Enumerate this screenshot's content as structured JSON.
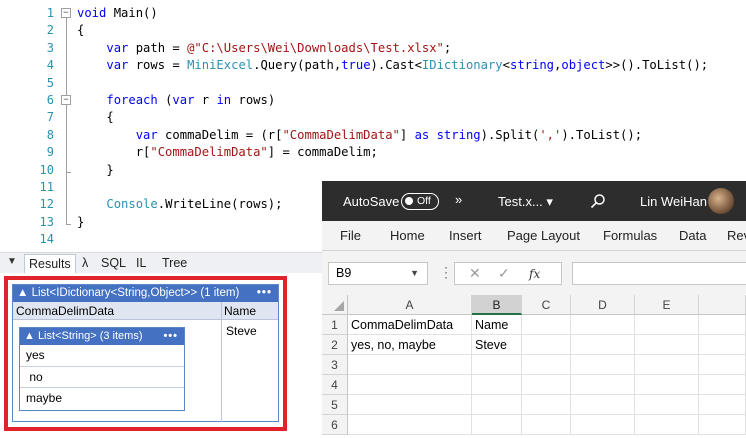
{
  "editor": {
    "lines": [
      {
        "n": "1",
        "parts": [
          {
            "t": "void",
            "c": "kw"
          },
          {
            "t": " Main()",
            "c": ""
          }
        ]
      },
      {
        "n": "2",
        "parts": [
          {
            "t": "{",
            "c": ""
          }
        ]
      },
      {
        "n": "3",
        "parts": [
          {
            "t": "    ",
            "c": ""
          },
          {
            "t": "var",
            "c": "kw"
          },
          {
            "t": " path = ",
            "c": ""
          },
          {
            "t": "@\"C:\\Users\\Wei\\Downloads\\Test.xlsx\"",
            "c": "str"
          },
          {
            "t": ";",
            "c": ""
          }
        ]
      },
      {
        "n": "4",
        "parts": [
          {
            "t": "    ",
            "c": ""
          },
          {
            "t": "var",
            "c": "kw"
          },
          {
            "t": " rows = ",
            "c": ""
          },
          {
            "t": "MiniExcel",
            "c": "ty"
          },
          {
            "t": ".Query(path,",
            "c": ""
          },
          {
            "t": "true",
            "c": "kw"
          },
          {
            "t": ").Cast<",
            "c": ""
          },
          {
            "t": "IDictionary",
            "c": "ty"
          },
          {
            "t": "<",
            "c": ""
          },
          {
            "t": "string",
            "c": "kw"
          },
          {
            "t": ",",
            "c": ""
          },
          {
            "t": "object",
            "c": "kw"
          },
          {
            "t": ">>().ToList();",
            "c": ""
          }
        ]
      },
      {
        "n": "5",
        "parts": [
          {
            "t": "",
            "c": ""
          }
        ]
      },
      {
        "n": "6",
        "parts": [
          {
            "t": "    ",
            "c": ""
          },
          {
            "t": "foreach",
            "c": "kw"
          },
          {
            "t": " (",
            "c": ""
          },
          {
            "t": "var",
            "c": "kw"
          },
          {
            "t": " r ",
            "c": ""
          },
          {
            "t": "in",
            "c": "kw"
          },
          {
            "t": " rows)",
            "c": ""
          }
        ]
      },
      {
        "n": "7",
        "parts": [
          {
            "t": "    {",
            "c": ""
          }
        ]
      },
      {
        "n": "8",
        "parts": [
          {
            "t": "        ",
            "c": ""
          },
          {
            "t": "var",
            "c": "kw"
          },
          {
            "t": " commaDelim = (r[",
            "c": ""
          },
          {
            "t": "\"CommaDelimData\"",
            "c": "str"
          },
          {
            "t": "] ",
            "c": ""
          },
          {
            "t": "as",
            "c": "kw"
          },
          {
            "t": " ",
            "c": ""
          },
          {
            "t": "string",
            "c": "kw"
          },
          {
            "t": ").Split(",
            "c": ""
          },
          {
            "t": "','",
            "c": "str"
          },
          {
            "t": ").ToList();",
            "c": ""
          }
        ]
      },
      {
        "n": "9",
        "parts": [
          {
            "t": "        r[",
            "c": ""
          },
          {
            "t": "\"CommaDelimData\"",
            "c": "str"
          },
          {
            "t": "] = commaDelim;",
            "c": ""
          }
        ]
      },
      {
        "n": "10",
        "parts": [
          {
            "t": "    }",
            "c": ""
          }
        ]
      },
      {
        "n": "11",
        "parts": [
          {
            "t": "",
            "c": ""
          }
        ]
      },
      {
        "n": "12",
        "parts": [
          {
            "t": "    ",
            "c": ""
          },
          {
            "t": "Console",
            "c": "ty"
          },
          {
            "t": ".WriteLine(rows);",
            "c": ""
          }
        ]
      },
      {
        "n": "13",
        "parts": [
          {
            "t": "}",
            "c": ""
          }
        ]
      },
      {
        "n": "14",
        "parts": [
          {
            "t": "",
            "c": ""
          }
        ]
      }
    ]
  },
  "results_tabs": {
    "items": [
      "Results",
      "λ",
      "SQL",
      "IL",
      "Tree"
    ],
    "active": "Results"
  },
  "dump": {
    "header": "▲ List<IDictionary<String,Object>> (1 item)",
    "menu": "•••",
    "columns": [
      "CommaDelimData",
      "Name"
    ],
    "name_value": "Steve",
    "inner_header": "▲ List<String> (3 items)",
    "inner_menu": "•••",
    "inner_items": [
      "yes",
      " no",
      "maybe"
    ]
  },
  "excel": {
    "autosave_label": "AutoSave",
    "toggle_label": "Off",
    "chevrons": "»",
    "filename": "Test.x... ▾",
    "search_icon": "⌕",
    "user_name": "Lin WeiHan",
    "ribbon_tabs": [
      "File",
      "Home",
      "Insert",
      "Page Layout",
      "Formulas",
      "Data",
      "Rev"
    ],
    "name_box": "B9",
    "columns": [
      "A",
      "B",
      "C",
      "D",
      "E"
    ],
    "selected_column": "B",
    "rows": [
      {
        "n": "1",
        "a": "CommaDelimData",
        "b": "Name"
      },
      {
        "n": "2",
        "a": "yes, no, maybe",
        "b": "Steve"
      },
      {
        "n": "3",
        "a": "",
        "b": ""
      },
      {
        "n": "4",
        "a": "",
        "b": ""
      },
      {
        "n": "5",
        "a": "",
        "b": ""
      },
      {
        "n": "6",
        "a": "",
        "b": ""
      }
    ]
  }
}
